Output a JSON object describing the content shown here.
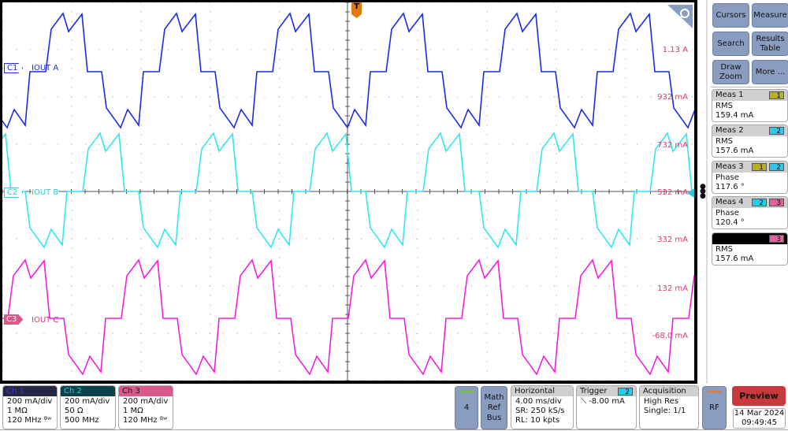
{
  "plot": {
    "channels": [
      {
        "id": "C1",
        "label": "IOUT A",
        "color": "#1a2ee0"
      },
      {
        "id": "C2",
        "label": "IOUT B",
        "color": "#2ee8f0"
      },
      {
        "id": "C3",
        "label": "IOUT C",
        "color": "#f020e0"
      }
    ],
    "scale_labels": [
      "1.13 A",
      "932 mA",
      "732 mA",
      "532 mA",
      "332 mA",
      "132 mA",
      "-68.0 mA"
    ],
    "trigger_marker": "T",
    "trigger_color": "#e07a10"
  },
  "side_panel": {
    "buttons": [
      "Cursors",
      "Measure",
      "Search",
      "Results Table",
      "Draw Zoom",
      "More ..."
    ],
    "measurements": [
      {
        "title": "Meas 1",
        "sources": [
          "1"
        ],
        "type": "RMS",
        "value": "159.4 mA"
      },
      {
        "title": "Meas 2",
        "sources": [
          "2"
        ],
        "type": "RMS",
        "value": "157.6 mA"
      },
      {
        "title": "Meas 3",
        "sources": [
          "1",
          "2"
        ],
        "type": "Phase",
        "value": "117.6 °"
      },
      {
        "title": "Meas 4",
        "sources": [
          "2",
          "3"
        ],
        "type": "Phase",
        "value": "120.4 °"
      },
      {
        "title": "",
        "sources": [
          "3"
        ],
        "type": "RMS",
        "value": "157.6 mA"
      }
    ]
  },
  "bottom": {
    "ch1": {
      "title": "Ch 1",
      "scale": "200 mA/div",
      "impedance": "1 MΩ",
      "bandwidth": "120 MHz ᴮʷ",
      "color": "#262645"
    },
    "ch2": {
      "title": "Ch 2",
      "scale": "200 mA/div",
      "impedance": "50 Ω",
      "bandwidth": "500 MHz",
      "color": "#0d4048"
    },
    "ch3": {
      "title": "Ch 3",
      "scale": "200 mA/div",
      "impedance": "1 MΩ",
      "bandwidth": "120 MHz ᴮʷ",
      "color": "#d65a8a"
    },
    "ch4_button": "4",
    "math_button": "Math Ref Bus",
    "horizontal": {
      "title": "Horizontal",
      "scale": "4.00 ms/div",
      "sr": "SR: 250 kS/s",
      "rl": "RL: 10 kpts"
    },
    "trigger": {
      "title": "Trigger",
      "source": "2",
      "level": "-8.00 mA"
    },
    "acquisition": {
      "title": "Acquisition",
      "mode": "High Res",
      "count": "Single: 1/1"
    },
    "rf_button": "RF",
    "preview_button": "Preview",
    "date": "14 Mar 2024",
    "time": "09:49:45"
  }
}
